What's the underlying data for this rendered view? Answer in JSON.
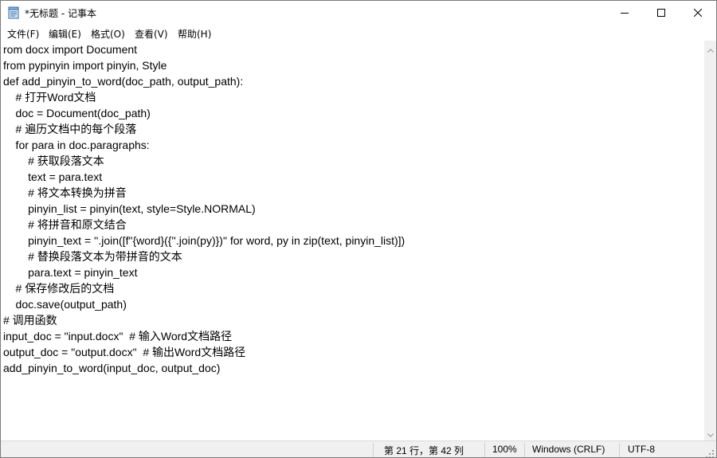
{
  "window": {
    "title": "*无标题 - 记事本"
  },
  "menu": {
    "items": [
      "文件(F)",
      "编辑(E)",
      "格式(O)",
      "查看(V)",
      "帮助(H)"
    ]
  },
  "editor": {
    "lines": [
      "rom docx import Document",
      "from pypinyin import pinyin, Style",
      "def add_pinyin_to_word(doc_path, output_path):",
      "    # 打开Word文档",
      "    doc = Document(doc_path)",
      "    # 遍历文档中的每个段落",
      "    for para in doc.paragraphs:",
      "        # 获取段落文本",
      "        text = para.text",
      "        # 将文本转换为拼音",
      "        pinyin_list = pinyin(text, style=Style.NORMAL)",
      "        # 将拼音和原文结合",
      "        pinyin_text = ''.join([f\"{word}({''.join(py)})\" for word, py in zip(text, pinyin_list)])",
      "        # 替换段落文本为带拼音的文本",
      "        para.text = pinyin_text",
      "    # 保存修改后的文档",
      "    doc.save(output_path)",
      "# 调用函数",
      "input_doc = \"input.docx\"  # 输入Word文档路径",
      "output_doc = \"output.docx\"  # 输出Word文档路径",
      "add_pinyin_to_word(input_doc, output_doc)"
    ]
  },
  "status": {
    "position": "第 21 行，第 42 列",
    "zoom": "100%",
    "line_ending": "Windows (CRLF)",
    "encoding": "UTF-8"
  }
}
